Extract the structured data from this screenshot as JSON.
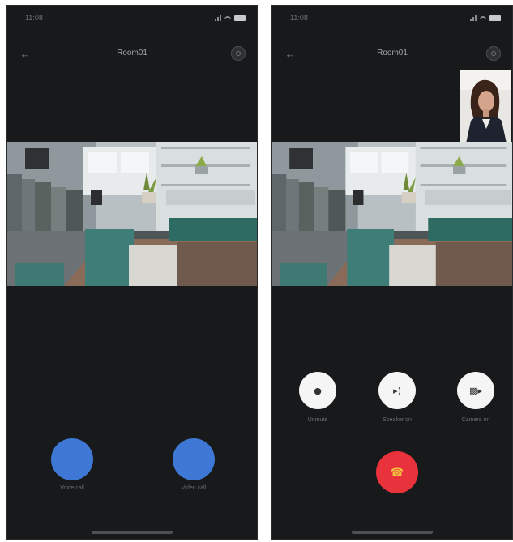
{
  "left_screen": {
    "status_time": "11:08",
    "title": "Room01",
    "actions": [
      {
        "label": "Voice call"
      },
      {
        "label": "Video call"
      }
    ]
  },
  "right_screen": {
    "status_time": "11:08",
    "title": "Room01",
    "controls": [
      {
        "label": "Unmute"
      },
      {
        "label": "Speaker on"
      },
      {
        "label": "Camera on"
      }
    ]
  },
  "icons": {
    "back": "back-arrow-icon",
    "settings": "settings-icon",
    "voice_call": "phone-icon",
    "video_call": "video-camera-icon",
    "mic": "microphone-icon",
    "speaker": "speaker-icon",
    "camera": "camera-icon",
    "hang_up": "hang-up-icon"
  },
  "colors": {
    "background": "#18191b",
    "accent_blue": "#3e78d4",
    "hang_up_red": "#e8323c",
    "control_white": "#f5f5f5"
  }
}
